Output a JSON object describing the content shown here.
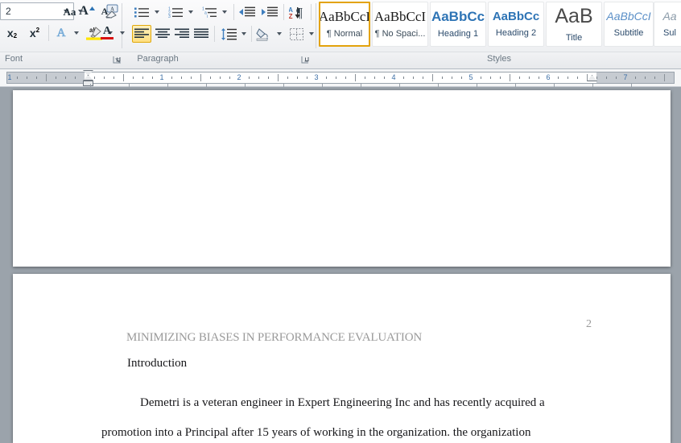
{
  "ribbon": {
    "groups": [
      {
        "name": "font",
        "label": "Font"
      },
      {
        "name": "paragraph",
        "label": "Paragraph"
      },
      {
        "name": "styles",
        "label": "Styles"
      }
    ],
    "font_group": {
      "size_value": "2",
      "size_placeholder": "Font Size",
      "buttons": [
        {
          "name": "grow-font",
          "label": "A",
          "tooltip": "Grow Font"
        },
        {
          "name": "shrink-font",
          "label": "A",
          "tooltip": "Shrink Font"
        },
        {
          "name": "change-case",
          "label": "Aa",
          "tooltip": "Change Case"
        },
        {
          "name": "clear-formatting",
          "label": "A",
          "tooltip": "Clear Formatting"
        },
        {
          "name": "subscript",
          "label": "x",
          "sub": "2",
          "tooltip": "Subscript"
        },
        {
          "name": "superscript",
          "label": "x",
          "sup": "2",
          "tooltip": "Superscript"
        },
        {
          "name": "text-effects",
          "label": "A",
          "tooltip": "Text Effects"
        },
        {
          "name": "text-highlight-color",
          "label": "ab",
          "tooltip": "Text Highlight Color"
        },
        {
          "name": "font-color",
          "label": "A",
          "tooltip": "Font Color"
        }
      ]
    },
    "paragraph_group": {
      "buttons": [
        {
          "name": "bullets",
          "tooltip": "Bullets"
        },
        {
          "name": "numbering",
          "tooltip": "Numbering"
        },
        {
          "name": "multilevel-list",
          "tooltip": "Multilevel List"
        },
        {
          "name": "decrease-indent",
          "tooltip": "Decrease Indent"
        },
        {
          "name": "increase-indent",
          "tooltip": "Increase Indent"
        },
        {
          "name": "sort",
          "tooltip": "Sort"
        },
        {
          "name": "show-formatting-marks",
          "label": "¶",
          "tooltip": "Show/Hide ¶"
        },
        {
          "name": "align-left",
          "tooltip": "Align Text Left",
          "selected": true
        },
        {
          "name": "align-center",
          "tooltip": "Center"
        },
        {
          "name": "align-right",
          "tooltip": "Align Text Right"
        },
        {
          "name": "justify",
          "tooltip": "Justify"
        },
        {
          "name": "line-spacing",
          "tooltip": "Line and Paragraph Spacing"
        },
        {
          "name": "shading",
          "tooltip": "Shading"
        },
        {
          "name": "borders",
          "tooltip": "Borders"
        }
      ]
    },
    "styles_gallery": [
      {
        "name": "normal",
        "preview": "AaBbCcI",
        "label": "¶ Normal",
        "selected": true
      },
      {
        "name": "no-spacing",
        "preview": "AaBbCcI",
        "label": "¶ No Spaci...",
        "selected": false
      },
      {
        "name": "heading-1",
        "preview": "AaBbCс",
        "label": "Heading 1",
        "selected": false
      },
      {
        "name": "heading-2",
        "preview": "AaBbCc",
        "label": "Heading 2",
        "selected": false
      },
      {
        "name": "title",
        "preview": "AaB",
        "label": "Title",
        "selected": false
      },
      {
        "name": "subtitle",
        "preview": "AaBbCcI",
        "label": "Subtitle",
        "selected": false
      },
      {
        "name": "subtle-emphasis",
        "preview": "Aa",
        "label": "Sul",
        "selected": false
      }
    ]
  },
  "ruler": {
    "numbers": [
      "1",
      "1",
      "2",
      "3",
      "4",
      "5",
      "6",
      "7"
    ],
    "unit": "inches"
  },
  "document": {
    "page_number": "2",
    "running_header": "MINIMIZING BIASES IN PERFORMANCE EVALUATION",
    "heading": "Introduction",
    "paragraph_lines": [
      "Demetri is a veteran engineer in Expert Engineering Inc and has recently acquired a",
      "promotion into a Principal  after 15 years of working in the organization. the organization"
    ]
  },
  "colors": {
    "accent_blue": "#2e74b5",
    "selection_gold": "#ffdf80",
    "ribbon_bg": "#f2f3f5",
    "canvas_gray": "#9ba3ab",
    "header_gray": "#9a9a9a",
    "body_text": "#17171a"
  }
}
